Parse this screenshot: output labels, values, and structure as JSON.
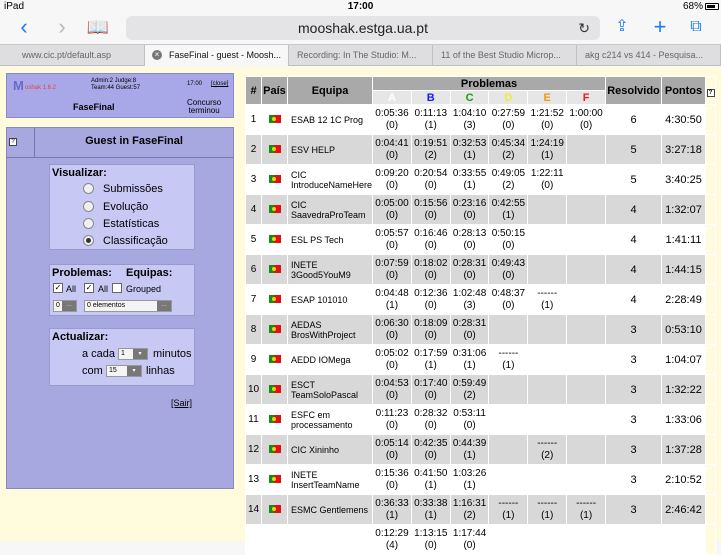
{
  "statusbar": {
    "device": "iPad",
    "time": "17:00",
    "battery": "68%"
  },
  "browser": {
    "url": "mooshak.estga.ua.pt",
    "tabs": [
      {
        "label": "www.cic.pt/default.asp"
      },
      {
        "label": "FaseFinal - guest - Moosh..."
      },
      {
        "label": "Recording: In The Studio: M..."
      },
      {
        "label": "11 of the Best Studio Microp..."
      },
      {
        "label": "akg c214 vs 414 - Pesquisa..."
      }
    ]
  },
  "header": {
    "logo": "M",
    "version": "oshak 1.6.2",
    "admin_judge": "Admin:2 Judge:8",
    "team_guest": "Team:44 Guest:57",
    "time": "17:00",
    "close_link": "[close]",
    "contest": "FaseFinal",
    "state_line1": "Concurso",
    "state_line2": "terminou"
  },
  "sidebar": {
    "title": "Guest in FaseFinal",
    "visualizar_label": "Visualizar:",
    "views": [
      {
        "label": "Submissões",
        "selected": false
      },
      {
        "label": "Evolução",
        "selected": false
      },
      {
        "label": "Estatísticas",
        "selected": false
      },
      {
        "label": "Classificação",
        "selected": true
      }
    ],
    "problemas_label": "Problemas:",
    "equipas_label": "Equipas:",
    "all_label": "All",
    "all2_label": "All",
    "grouped_label": "Grouped",
    "prob_select": "0",
    "team_select": "0 elementos",
    "actualizar_label": "Actualizar:",
    "a_cada": "a cada",
    "minutes_value": "1",
    "minutos": "minutos",
    "com": "com",
    "lines_value": "15",
    "linhas": "linhas",
    "sair": "[Sair]"
  },
  "table": {
    "headers": {
      "rank": "#",
      "country": "País",
      "team": "Equipa",
      "problems": "Problemas",
      "solved": "Resolvido",
      "points": "Pontos"
    },
    "problems": [
      {
        "letter": "A",
        "color": "#ffffff"
      },
      {
        "letter": "B",
        "color": "#1a1aee"
      },
      {
        "letter": "C",
        "color": "#1a9a1a"
      },
      {
        "letter": "D",
        "color": "#eeee33"
      },
      {
        "letter": "E",
        "color": "#ee9a1a"
      },
      {
        "letter": "F",
        "color": "#ee1a1a"
      }
    ],
    "rows": [
      {
        "rank": "1",
        "team": "ESAB 12 1C Prog",
        "cells": [
          [
            "0:05:36",
            "(0)"
          ],
          [
            "0:11:13",
            "(1)"
          ],
          [
            "1:04:10",
            "(3)"
          ],
          [
            "0:27:59",
            "(0)"
          ],
          [
            "1:21:52",
            "(0)"
          ],
          [
            "1:00:00",
            "(0)"
          ]
        ],
        "solved": "6",
        "points": "4:30:50"
      },
      {
        "rank": "2",
        "team": "ESV HELP",
        "cells": [
          [
            "0:04:41",
            "(0)"
          ],
          [
            "0:19:51",
            "(2)"
          ],
          [
            "0:32:53",
            "(1)"
          ],
          [
            "0:45:34",
            "(2)"
          ],
          [
            "1:24:19",
            "(1)"
          ],
          [
            "",
            ""
          ]
        ],
        "solved": "5",
        "points": "3:27:18"
      },
      {
        "rank": "3",
        "team": "CIC IntroduceNameHere",
        "cells": [
          [
            "0:09:20",
            "(0)"
          ],
          [
            "0:20:54",
            "(0)"
          ],
          [
            "0:33:55",
            "(1)"
          ],
          [
            "0:49:05",
            "(2)"
          ],
          [
            "1:22:11",
            "(0)"
          ],
          [
            "",
            ""
          ]
        ],
        "solved": "5",
        "points": "3:40:25"
      },
      {
        "rank": "4",
        "team": "CIC SaavedraProTeam",
        "cells": [
          [
            "0:05:00",
            "(0)"
          ],
          [
            "0:15:56",
            "(0)"
          ],
          [
            "0:23:16",
            "(0)"
          ],
          [
            "0:42:55",
            "(1)"
          ],
          [
            "",
            ""
          ],
          [
            "",
            ""
          ]
        ],
        "solved": "4",
        "points": "1:32:07"
      },
      {
        "rank": "5",
        "team": "ESL PS Tech",
        "cells": [
          [
            "0:05:57",
            "(0)"
          ],
          [
            "0:16:46",
            "(0)"
          ],
          [
            "0:28:13",
            "(0)"
          ],
          [
            "0:50:15",
            "(0)"
          ],
          [
            "",
            ""
          ],
          [
            "",
            ""
          ]
        ],
        "solved": "4",
        "points": "1:41:11"
      },
      {
        "rank": "6",
        "team": "INETE 3Good5YouM9",
        "cells": [
          [
            "0:07:59",
            "(0)"
          ],
          [
            "0:18:02",
            "(0)"
          ],
          [
            "0:28:31",
            "(0)"
          ],
          [
            "0:49:43",
            "(0)"
          ],
          [
            "",
            ""
          ],
          [
            "",
            ""
          ]
        ],
        "solved": "4",
        "points": "1:44:15"
      },
      {
        "rank": "7",
        "team": "ESAP 101010",
        "cells": [
          [
            "0:04:48",
            "(1)"
          ],
          [
            "0:12:36",
            "(0)"
          ],
          [
            "1:02:48",
            "(3)"
          ],
          [
            "0:48:37",
            "(0)"
          ],
          [
            "------",
            "(1)"
          ],
          [
            "",
            ""
          ]
        ],
        "solved": "4",
        "points": "2:28:49"
      },
      {
        "rank": "8",
        "team": "AEDAS BrosWithProject",
        "cells": [
          [
            "0:06:30",
            "(0)"
          ],
          [
            "0:18:09",
            "(0)"
          ],
          [
            "0:28:31",
            "(0)"
          ],
          [
            "",
            ""
          ],
          [
            "",
            ""
          ],
          [
            "",
            ""
          ]
        ],
        "solved": "3",
        "points": "0:53:10"
      },
      {
        "rank": "9",
        "team": "AEDD IOMega",
        "cells": [
          [
            "0:05:02",
            "(0)"
          ],
          [
            "0:17:59",
            "(1)"
          ],
          [
            "0:31:06",
            "(1)"
          ],
          [
            "------",
            "(1)"
          ],
          [
            "",
            ""
          ],
          [
            "",
            ""
          ]
        ],
        "solved": "3",
        "points": "1:04:07"
      },
      {
        "rank": "10",
        "team": "ESCT TeamSoloPascal",
        "cells": [
          [
            "0:04:53",
            "(0)"
          ],
          [
            "0:17:40",
            "(0)"
          ],
          [
            "0:59:49",
            "(2)"
          ],
          [
            "",
            ""
          ],
          [
            "",
            ""
          ],
          [
            "",
            ""
          ]
        ],
        "solved": "3",
        "points": "1:32:22"
      },
      {
        "rank": "11",
        "team": "ESFC em processamento",
        "cells": [
          [
            "0:11:23",
            "(0)"
          ],
          [
            "0:28:32",
            "(0)"
          ],
          [
            "0:53:11",
            "(0)"
          ],
          [
            "",
            ""
          ],
          [
            "",
            ""
          ],
          [
            "",
            ""
          ]
        ],
        "solved": "3",
        "points": "1:33:06"
      },
      {
        "rank": "12",
        "team": "CIC Xininho",
        "cells": [
          [
            "0:05:14",
            "(0)"
          ],
          [
            "0:42:35",
            "(0)"
          ],
          [
            "0:44:39",
            "(1)"
          ],
          [
            "",
            ""
          ],
          [
            "------",
            "(2)"
          ],
          [
            "",
            ""
          ]
        ],
        "solved": "3",
        "points": "1:37:28"
      },
      {
        "rank": "13",
        "team": "INETE InsertTeamName",
        "cells": [
          [
            "0:15:36",
            "(0)"
          ],
          [
            "0:41:50",
            "(1)"
          ],
          [
            "1:03:26",
            "(1)"
          ],
          [
            "",
            ""
          ],
          [
            "",
            ""
          ],
          [
            "",
            ""
          ]
        ],
        "solved": "3",
        "points": "2:10:52"
      },
      {
        "rank": "14",
        "team": "ESMC Gentlemens",
        "cells": [
          [
            "0:36:33",
            "(1)"
          ],
          [
            "0:33:38",
            "(1)"
          ],
          [
            "1:16:31",
            "(2)"
          ],
          [
            "------",
            "(1)"
          ],
          [
            "------",
            "(1)"
          ],
          [
            "------",
            "(1)"
          ]
        ],
        "solved": "3",
        "points": "2:46:42"
      },
      {
        "rank": "",
        "team": "",
        "cells": [
          [
            "0:12:29",
            "(4)"
          ],
          [
            "1:13:15",
            "(0)"
          ],
          [
            "1:17:44",
            "(0)"
          ],
          [
            "",
            ""
          ],
          [
            "",
            ""
          ],
          [
            "",
            ""
          ]
        ],
        "solved": "",
        "points": ""
      }
    ]
  }
}
